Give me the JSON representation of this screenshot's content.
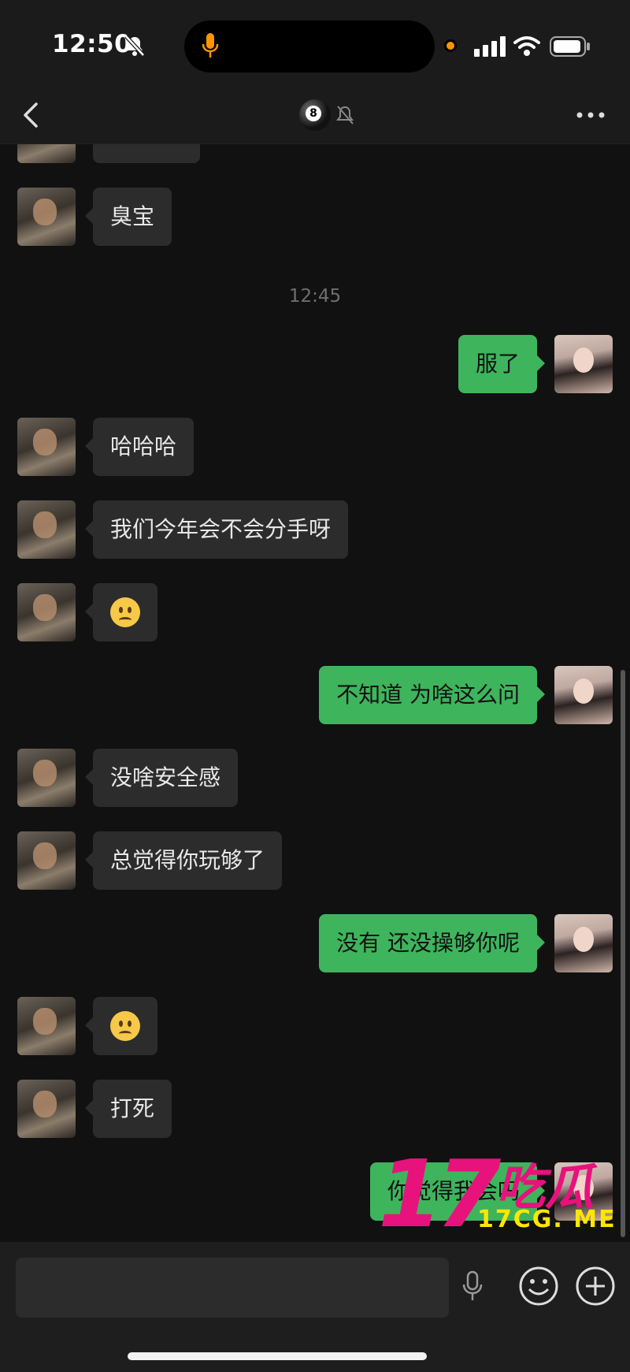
{
  "status_bar": {
    "time": "12:50",
    "icons": [
      "bell-slash-icon",
      "microphone-icon",
      "orange-dot-icon",
      "signal-icon",
      "wifi-icon",
      "battery-icon"
    ]
  },
  "nav": {
    "title_emoji": "8",
    "icons": [
      "chevron-left-icon",
      "billiard-ball-icon",
      "mute-bell-icon",
      "more-icon"
    ]
  },
  "messages": [
    {
      "side": "left",
      "text": "臭宝"
    },
    {
      "side": "left",
      "text": "哈哈哈"
    },
    {
      "side": "left",
      "text": "我们今年会不会分手呀"
    },
    {
      "side": "left",
      "emoji": "frown-emoji-icon"
    },
    {
      "side": "right",
      "text": "不知道 为啥这么问"
    },
    {
      "side": "left",
      "text": "没啥安全感"
    },
    {
      "side": "left",
      "text": "总觉得你玩够了"
    },
    {
      "side": "right",
      "text": "没有 还没操够你呢"
    },
    {
      "side": "left",
      "emoji": "frown-emoji-icon"
    },
    {
      "side": "left",
      "text": "打死"
    },
    {
      "side": "right",
      "text": "你觉得我会吗"
    }
  ],
  "msg_served": "服了",
  "timestamp": "12:45",
  "watermark": {
    "big": "17",
    "cn": "吃瓜",
    "url": "17CG. ME"
  },
  "colors": {
    "accent_green": "#3eb45d",
    "bubble_dark": "#2c2c2c",
    "background": "#111111",
    "watermark_pink": "#e8127d",
    "watermark_yellow": "#ffe600"
  }
}
